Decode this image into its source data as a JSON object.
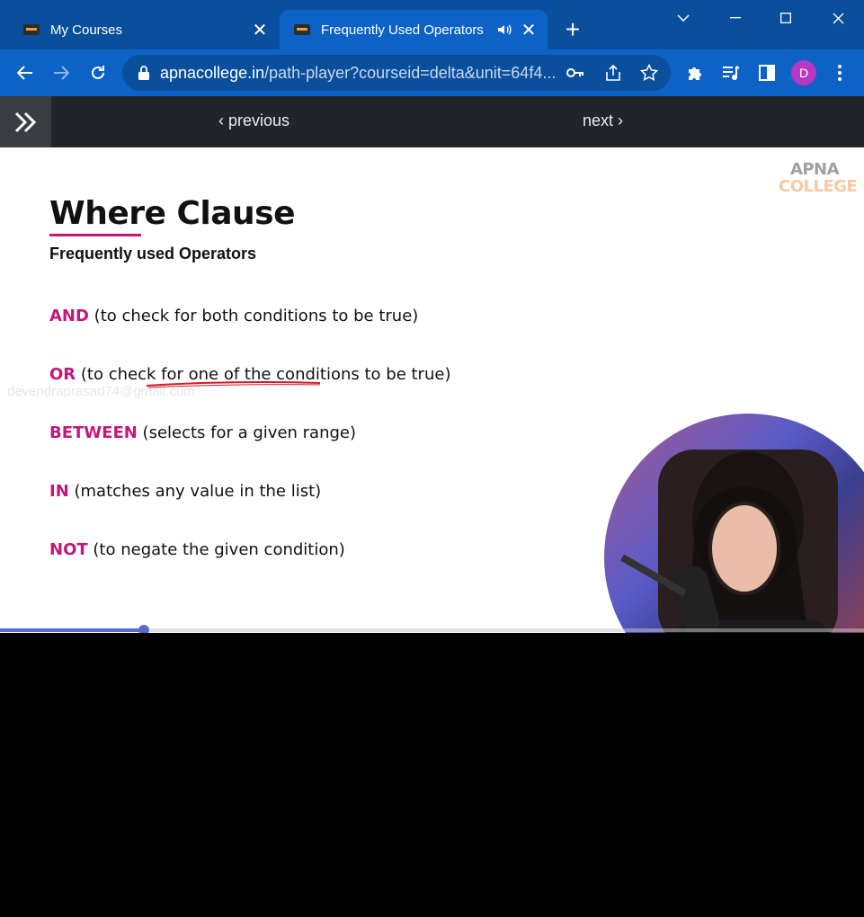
{
  "window": {
    "controls": [
      "chevron-down",
      "minimize",
      "maximize",
      "close"
    ]
  },
  "tabs": [
    {
      "title": "My Courses",
      "favicon_text": "COLLEGE",
      "active": false
    },
    {
      "title": "Frequently Used Operators",
      "favicon_text": "COLLEGE",
      "active": true,
      "audio": true
    }
  ],
  "toolbar": {
    "url_host": "apnacollege.in",
    "url_rest": "/path-player?courseid=delta&unit=64f4...",
    "profile_initial": "D",
    "accent": "#0c63c5"
  },
  "page_nav": {
    "previous_label": "previous",
    "next_label": "next"
  },
  "slide": {
    "logo_line1": "APNA",
    "logo_line2": "COLLEGE",
    "title": "Where Clause",
    "subtitle": "Frequently used Operators",
    "watermark": "devendraprasad74@gmail.com",
    "operators": [
      {
        "keyword": "AND",
        "description": "(to check for both conditions to be true)"
      },
      {
        "keyword": "OR",
        "description": "(to check for one of the conditions to be true)"
      },
      {
        "keyword": "BETWEEN",
        "description": "(selects for a given range)"
      },
      {
        "keyword": "IN",
        "description": "(matches any value in the list)"
      },
      {
        "keyword": "NOT",
        "description": "(to negate the given condition)"
      }
    ],
    "keyword_color": "#c2187a"
  },
  "player": {
    "progress": 0.167,
    "progress_color": "#5b6bc9"
  }
}
